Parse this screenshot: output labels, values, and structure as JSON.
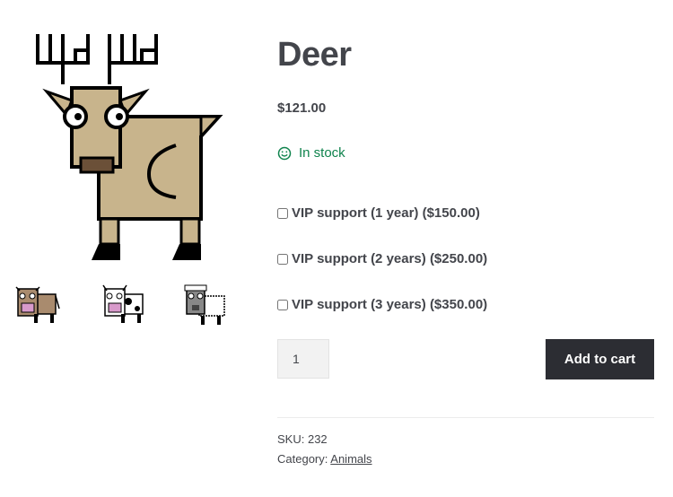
{
  "product": {
    "title": "Deer",
    "price": "$121.00",
    "stock_status": "In stock",
    "addons": [
      {
        "label": "VIP support (1 year) ($150.00)",
        "checked": false
      },
      {
        "label": "VIP support (2 years) ($250.00)",
        "checked": false
      },
      {
        "label": "VIP support (3 years) ($350.00)",
        "checked": false
      }
    ],
    "quantity": "1",
    "add_to_cart_label": "Add to cart",
    "sku_label": "SKU:",
    "sku_value": "232",
    "category_label": "Category:",
    "category_value": "Animals"
  },
  "gallery": {
    "main_image": "deer-image",
    "thumbnails": [
      "cow-brown-thumbnail",
      "cow-spotted-thumbnail",
      "sheep-thumbnail"
    ]
  },
  "colors": {
    "text": "#43454b",
    "stock_green": "#0f834d",
    "button_bg": "#2c2d33",
    "button_text": "#ffffff",
    "deer_body": "#c8b48c",
    "deer_nose": "#6b5038"
  }
}
